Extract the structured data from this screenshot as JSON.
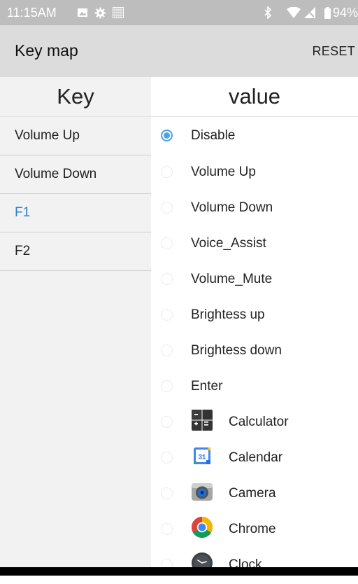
{
  "status": {
    "time": "11:15AM",
    "battery": "94%",
    "icons": [
      "image-icon",
      "settings-icon",
      "keyboard-icon",
      "bluetooth-icon",
      "wifi-icon",
      "no-signal-icon",
      "battery-icon"
    ]
  },
  "toolbar": {
    "title": "Key map",
    "reset_label": "RESET"
  },
  "columns": {
    "key_header": "Key",
    "value_header": "value"
  },
  "keys": [
    {
      "label": "Volume Up",
      "selected": false
    },
    {
      "label": "Volume Down",
      "selected": false
    },
    {
      "label": "F1",
      "selected": true
    },
    {
      "label": "F2",
      "selected": false
    }
  ],
  "options": [
    {
      "label": "Disable",
      "checked": true
    },
    {
      "label": "Volume Up",
      "checked": false
    },
    {
      "label": "Volume Down",
      "checked": false
    },
    {
      "label": "Voice_Assist",
      "checked": false
    },
    {
      "label": "Volume_Mute",
      "checked": false
    },
    {
      "label": "Brightess up",
      "checked": false
    },
    {
      "label": "Brightess down",
      "checked": false
    },
    {
      "label": "Enter",
      "checked": false
    },
    {
      "label": "Calculator",
      "checked": false,
      "icon": "calculator-app-icon"
    },
    {
      "label": "Calendar",
      "checked": false,
      "icon": "calendar-app-icon",
      "icon_text": "31"
    },
    {
      "label": "Camera",
      "checked": false,
      "icon": "camera-app-icon"
    },
    {
      "label": "Chrome",
      "checked": false,
      "icon": "chrome-app-icon"
    },
    {
      "label": "Clock",
      "checked": false,
      "icon": "clock-app-icon"
    }
  ],
  "colors": {
    "accent": "#2c7fd2",
    "radio_checked": "#4da3e6",
    "toolbar": "#dcdcdc",
    "status_bar": "#bdbdbd"
  }
}
